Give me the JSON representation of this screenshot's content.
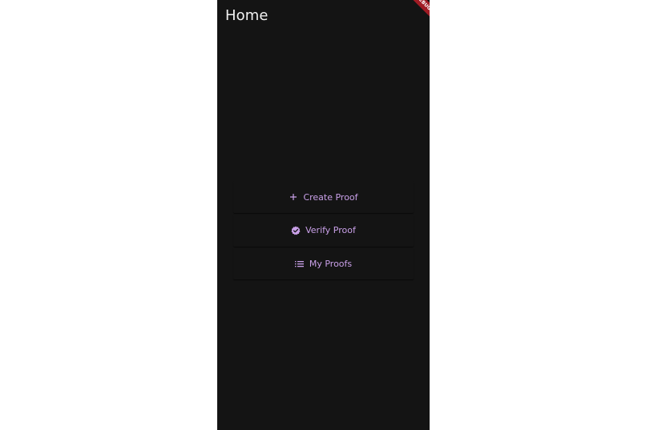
{
  "app": {
    "title": "Home",
    "debug_banner": "DEBUG"
  },
  "colors": {
    "background": "#141414",
    "accent": "#c9a0e8",
    "title_text": "#f2f2f2",
    "banner": "#a01b24"
  },
  "menu": {
    "items": [
      {
        "label": "Create Proof",
        "icon": "plus-icon"
      },
      {
        "label": "Verify Proof",
        "icon": "verified-check-icon"
      },
      {
        "label": "My Proofs",
        "icon": "list-icon"
      }
    ]
  }
}
